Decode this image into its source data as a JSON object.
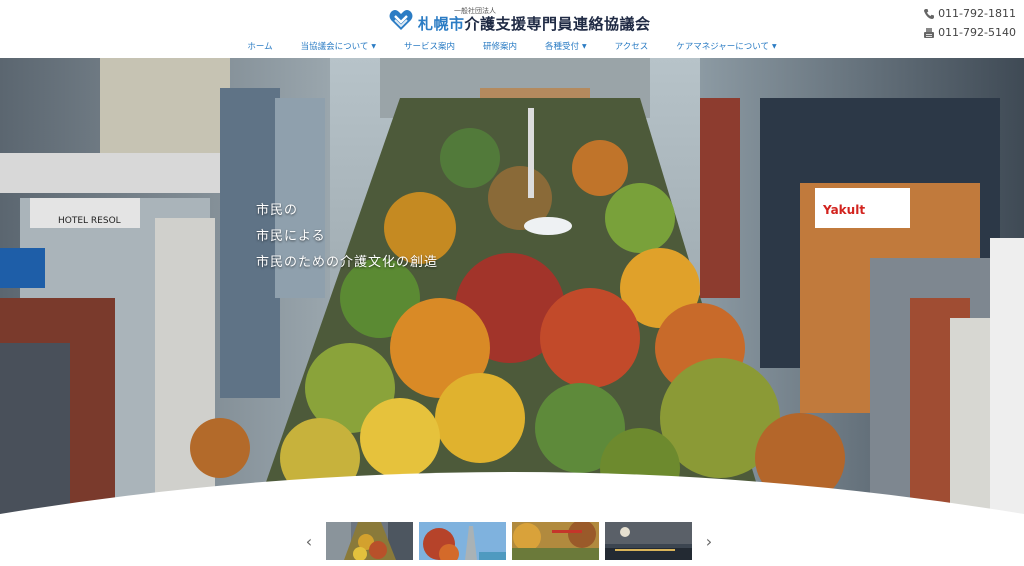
{
  "header": {
    "org_small": "一般社団法人",
    "org_prefix": "札幌市",
    "org_rest": "介護支援専門員連絡協議会",
    "phone": "011-792-1811",
    "fax": "011-792-5140",
    "phone_icon": "phone-icon",
    "fax_icon": "fax-icon"
  },
  "nav": {
    "items": [
      {
        "label": "ホーム",
        "dropdown": false
      },
      {
        "label": "当協議会について",
        "dropdown": true
      },
      {
        "label": "サービス案内",
        "dropdown": false
      },
      {
        "label": "研修案内",
        "dropdown": false
      },
      {
        "label": "各種受付",
        "dropdown": true
      },
      {
        "label": "アクセス",
        "dropdown": false
      },
      {
        "label": "ケアマネジャーについて",
        "dropdown": true
      }
    ]
  },
  "hero": {
    "line1": "市民の",
    "line2": "市民による",
    "line3": "市民のための介護文化の創造",
    "sign_hotel": "HOTEL RESOL",
    "sign_yakult": "Yakult"
  },
  "carousel": {
    "prev_icon": "chevron-left-icon",
    "next_icon": "chevron-right-icon",
    "thumbnails": [
      "autumn-park-thumbnail",
      "tower-thumbnail",
      "autumn-valley-thumbnail",
      "night-fireworks-thumbnail"
    ]
  },
  "colors": {
    "brand_blue": "#2b7cc4",
    "brand_dark": "#1f2a44"
  }
}
